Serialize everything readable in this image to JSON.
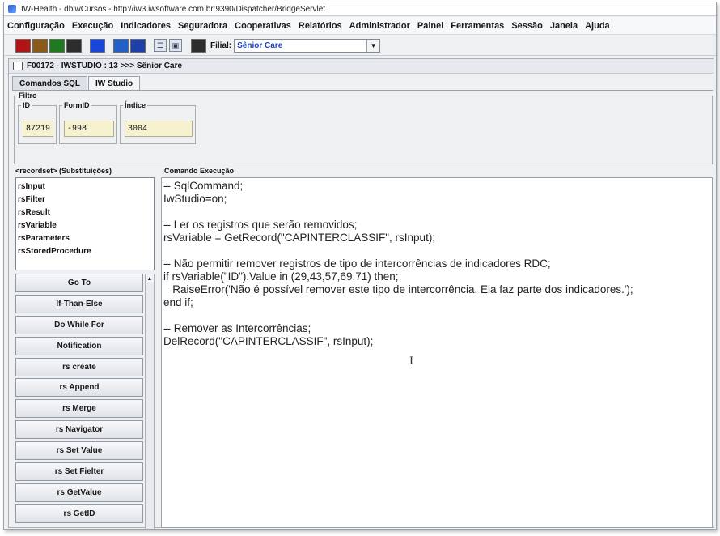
{
  "window": {
    "title": "IW-Health - dblwCursos - http://iw3.iwsoftware.com.br:9390/Dispatcher/BridgeServlet"
  },
  "menu": [
    "Configuração",
    "Execução",
    "Indicadores",
    "Seguradora",
    "Cooperativas",
    "Relatórios",
    "Administrador",
    "Painel",
    "Ferramentas",
    "Sessão",
    "Janela",
    "Ajuda"
  ],
  "toolbar": {
    "color_buttons": [
      "#b11414",
      "#8a5a19",
      "#1f7a1f",
      "#2d2d2d",
      "#1846d6",
      "#2060c8",
      "#1e3fa8"
    ],
    "filial_label": "Filial:",
    "filial_value": "Sênior Care"
  },
  "frame": {
    "title": "F00172 - IWSTUDIO : 13 >>> Sênior Care"
  },
  "tabs": [
    "Comandos SQL",
    "IW Studio"
  ],
  "filtro": {
    "label": "Filtro",
    "fields": [
      {
        "label": "ID",
        "value": "87219"
      },
      {
        "label": "FormID",
        "value": "-998"
      },
      {
        "label": "Índice",
        "value": "3004"
      }
    ]
  },
  "recordset": {
    "label": "<recordset> (Substituições)",
    "items": [
      "rsInput",
      "rsFilter",
      "rsResult",
      "rsVariable",
      "rsParameters",
      "rsStoredProcedure"
    ]
  },
  "commands": [
    "Go To",
    "If-Than-Else",
    "Do While For",
    "Notification",
    "rs create",
    "rs Append",
    "rs Merge",
    "rs Navigator",
    "rs Set Value",
    "rs Set Fielter",
    "rs GetValue",
    "rs GetID"
  ],
  "editor": {
    "label": "Comando Execução",
    "lines": [
      "-- SqlCommand;",
      "IwStudio=on;",
      "",
      "-- Ler os registros que serão removidos;",
      "rsVariable = GetRecord(\"CAPINTERCLASSIF\", rsInput);",
      "",
      "-- Não permitir remover registros de tipo de intercorrências de indicadores RDC;",
      "if rsVariable(\"ID\").Value in (29,43,57,69,71) then;",
      "   RaiseError('Não é possível remover este tipo de intercorrência. Ela faz parte dos indicadores.');",
      "end if;",
      "",
      "-- Remover as Intercorrências;",
      "DelRecord(\"CAPINTERCLASSIF\", rsInput);"
    ]
  }
}
